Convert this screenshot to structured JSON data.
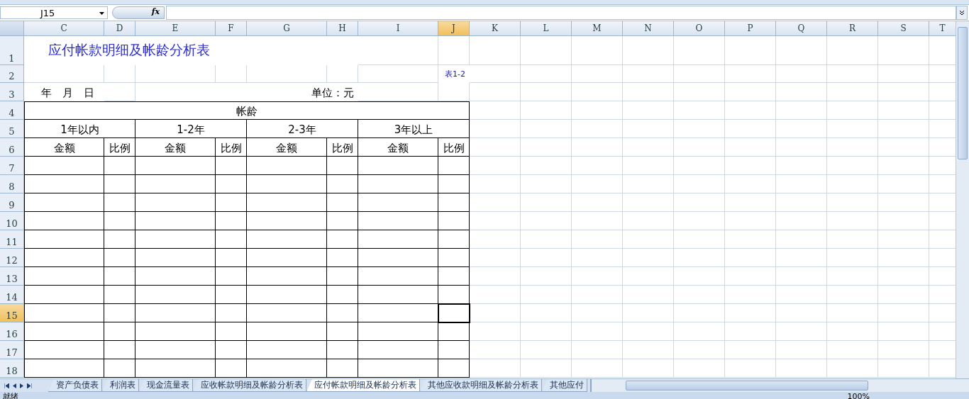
{
  "formula_bar": {
    "name_box": "J15",
    "function_label": "fx"
  },
  "columns": [
    {
      "label": "C",
      "selected": false
    },
    {
      "label": "D",
      "selected": false
    },
    {
      "label": "E",
      "selected": false
    },
    {
      "label": "F",
      "selected": false
    },
    {
      "label": "G",
      "selected": false
    },
    {
      "label": "H",
      "selected": false
    },
    {
      "label": "I",
      "selected": false
    },
    {
      "label": "J",
      "selected": true
    },
    {
      "label": "K",
      "selected": false
    },
    {
      "label": "L",
      "selected": false
    },
    {
      "label": "M",
      "selected": false
    },
    {
      "label": "N",
      "selected": false
    },
    {
      "label": "O",
      "selected": false
    },
    {
      "label": "P",
      "selected": false
    },
    {
      "label": "Q",
      "selected": false
    },
    {
      "label": "R",
      "selected": false
    },
    {
      "label": "S",
      "selected": false
    },
    {
      "label": "T",
      "selected": false
    }
  ],
  "rows": [
    {
      "label": "1",
      "selected": false
    },
    {
      "label": "2",
      "selected": false
    },
    {
      "label": "3",
      "selected": false
    },
    {
      "label": "4",
      "selected": false
    },
    {
      "label": "5",
      "selected": false
    },
    {
      "label": "6",
      "selected": false
    },
    {
      "label": "7",
      "selected": false
    },
    {
      "label": "8",
      "selected": false
    },
    {
      "label": "9",
      "selected": false
    },
    {
      "label": "10",
      "selected": false
    },
    {
      "label": "11",
      "selected": false
    },
    {
      "label": "12",
      "selected": false
    },
    {
      "label": "13",
      "selected": false
    },
    {
      "label": "14",
      "selected": false
    },
    {
      "label": "15",
      "selected": true
    },
    {
      "label": "16",
      "selected": false
    },
    {
      "label": "17",
      "selected": false
    },
    {
      "label": "18",
      "selected": false
    }
  ],
  "sheet": {
    "title": "应付帐款明细及帐龄分析表",
    "table_number": "表1-2",
    "date": "年　月　日",
    "unit": "单位：元",
    "group_header": "帐龄",
    "periods": [
      "1年以内",
      "1-2年",
      "2-3年",
      "3年以上"
    ],
    "subheaders": [
      "金额",
      "比例",
      "金额",
      "比例",
      "金额",
      "比例",
      "金额",
      "比例"
    ]
  },
  "sheet_tabs": [
    {
      "label": "资产负债表",
      "selected": false
    },
    {
      "label": "利润表",
      "selected": false
    },
    {
      "label": "现金流量表",
      "selected": false
    },
    {
      "label": "应收帐款明细及帐龄分析表",
      "selected": false
    },
    {
      "label": "应付帐款明细及帐龄分析表",
      "selected": true
    },
    {
      "label": "其他应收款明细及帐龄分析表",
      "selected": false
    },
    {
      "label": "其他应付",
      "selected": false
    }
  ],
  "status_bar": {
    "status": "就绪",
    "zoom": "100%"
  }
}
